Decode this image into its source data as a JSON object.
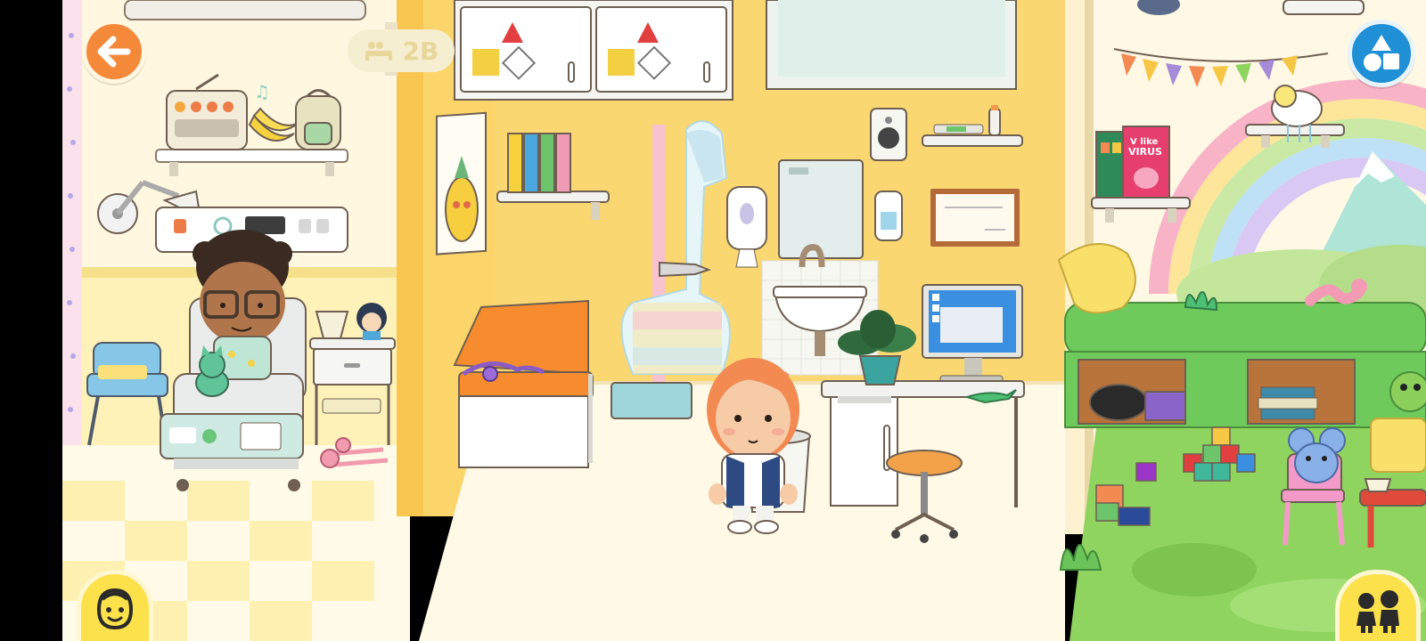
{
  "game": {
    "room_number": "2B",
    "book_title_line1": "V like",
    "book_title_line2": "VIRUS"
  },
  "hud": {
    "back_icon": "arrow-left-icon",
    "shapes_icon": "shapes-icon",
    "character_icon": "smiley-face-icon",
    "family_icon": "two-people-icon"
  },
  "colors": {
    "back_button": "#f5893a",
    "shapes_button": "#1f8fd6",
    "character_button": "#fde14a",
    "family_button": "#fde14a",
    "wall_yellow": "#fbd56a",
    "grass": "#8fd45f",
    "floor": "#fff9e6"
  }
}
